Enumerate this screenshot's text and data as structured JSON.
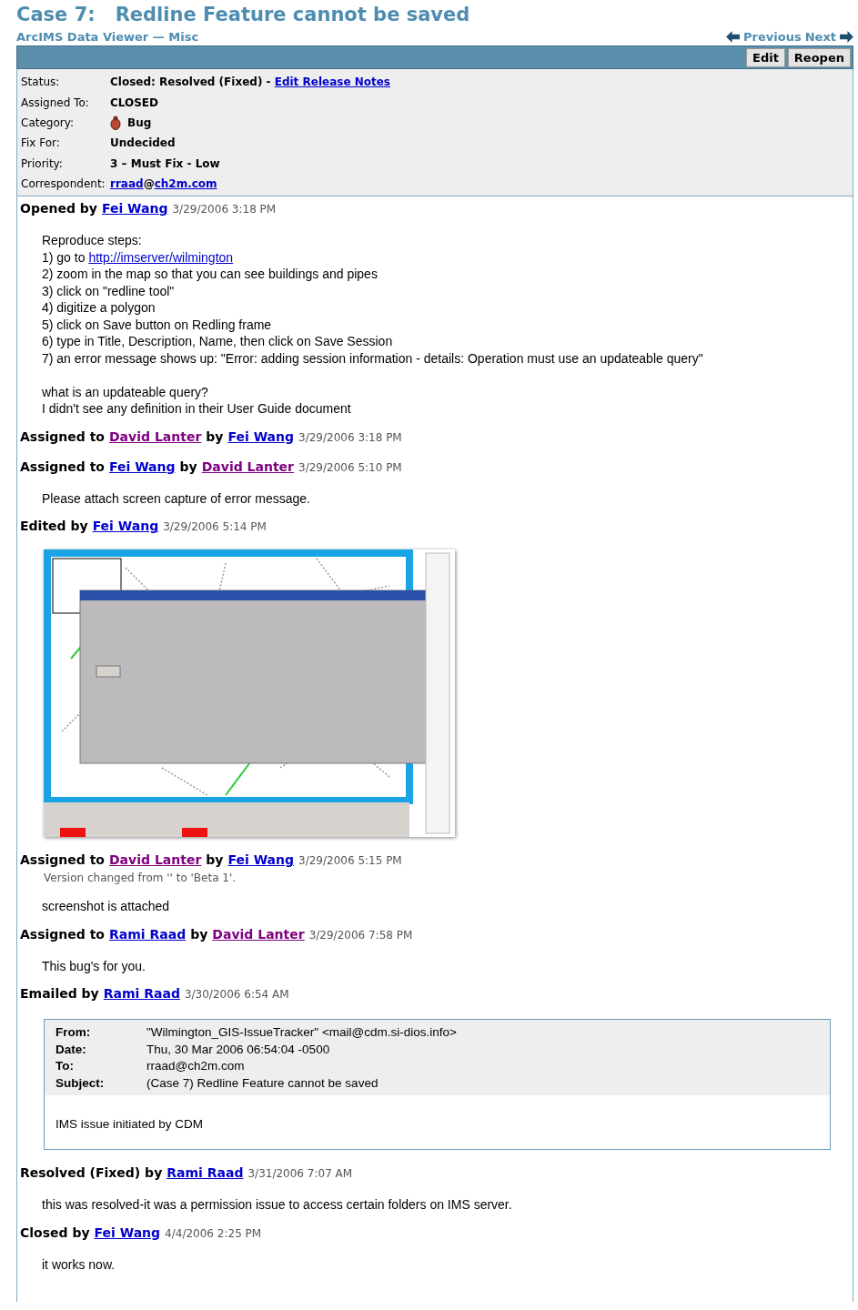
{
  "case": {
    "number": "Case 7:",
    "title": "Redline Feature cannot be saved",
    "subtitle": "ArcIMS Data Viewer — Misc"
  },
  "nav": {
    "previous": "Previous",
    "next": "Next"
  },
  "buttons": [
    "Edit",
    "Reopen"
  ],
  "properties": [
    {
      "label": "Status:",
      "kind": "text",
      "parts": [
        {
          "kind": "text",
          "text": "Closed: Resolved (Fixed) - "
        },
        {
          "kind": "link",
          "text": "Edit Release Notes"
        }
      ]
    },
    {
      "label": "Assigned To:",
      "kind": "text",
      "parts": [
        {
          "kind": "text",
          "text": "CLOSED"
        }
      ]
    },
    {
      "label": "Category:",
      "kind": "category",
      "parts": [
        {
          "kind": "text",
          "text": "Bug"
        }
      ]
    },
    {
      "label": "Fix For:",
      "kind": "text",
      "parts": [
        {
          "kind": "text",
          "text": "Undecided"
        }
      ]
    },
    {
      "label": "Priority:",
      "kind": "text",
      "parts": [
        {
          "kind": "text",
          "text": "3 – Must Fix - Low"
        }
      ]
    },
    {
      "label": "Correspondent:",
      "kind": "text",
      "parts": [
        {
          "kind": "link",
          "text": "rraad"
        },
        {
          "kind": "text",
          "text": "@"
        },
        {
          "kind": "link",
          "text": "ch2m.com"
        }
      ]
    }
  ],
  "events": [
    {
      "heading": [
        {
          "kind": "text",
          "text": "Opened by"
        },
        {
          "kind": "link",
          "text": "Fei Wang",
          "visited": false
        }
      ],
      "time": "3/29/2006 3:18 PM",
      "paragraphs": [
        [
          {
            "text": "Reproduce steps:"
          },
          {
            "text": "1) go to ",
            "link": "http://imserver/wilmington"
          },
          {
            "text": "2) zoom in the map so that you can see buildings and pipes"
          },
          {
            "text": "3) click on \"redline tool\""
          },
          {
            "text": "4) digitize a polygon"
          },
          {
            "text": "5) click on Save button on Redling frame"
          },
          {
            "text": "6) type in Title, Description, Name, then click on Save Session"
          },
          {
            "text": "7) an error message shows up: \"Error: adding session information - details: Operation must use an updateable query\""
          }
        ],
        [
          {
            "text": "what is an updateable query?"
          },
          {
            "text": "I didn't see any definition in their User Guide document"
          }
        ]
      ]
    },
    {
      "heading": [
        {
          "kind": "text",
          "text": "Assigned to"
        },
        {
          "kind": "link",
          "text": "David Lanter",
          "visited": true
        },
        {
          "kind": "text",
          "text": "by"
        },
        {
          "kind": "link",
          "text": "Fei Wang",
          "visited": false
        }
      ],
      "time": "3/29/2006 3:18 PM"
    },
    {
      "heading": [
        {
          "kind": "text",
          "text": "Assigned to"
        },
        {
          "kind": "link",
          "text": "Fei Wang",
          "visited": false
        },
        {
          "kind": "text",
          "text": "by"
        },
        {
          "kind": "link",
          "text": "David Lanter",
          "visited": true
        }
      ],
      "time": "3/29/2006 5:10 PM",
      "paragraphs": [
        [
          {
            "text": "Please attach screen capture of error message."
          }
        ]
      ]
    },
    {
      "heading": [
        {
          "kind": "text",
          "text": "Edited by"
        },
        {
          "kind": "link",
          "text": "Fei Wang",
          "visited": false
        }
      ],
      "time": "3/29/2006 5:14 PM",
      "attachment": {
        "kind": "picture"
      }
    },
    {
      "heading": [
        {
          "kind": "text",
          "text": "Assigned to"
        },
        {
          "kind": "link",
          "text": "David Lanter",
          "visited": true
        },
        {
          "kind": "text",
          "text": "by"
        },
        {
          "kind": "link",
          "text": "Fei Wang",
          "visited": false
        }
      ],
      "time": "3/29/2006 5:15 PM",
      "note": "Version changed from '' to 'Beta 1'.",
      "paragraphs": [
        [
          {
            "text": "screenshot is attached"
          }
        ]
      ]
    },
    {
      "heading": [
        {
          "kind": "text",
          "text": "Assigned to"
        },
        {
          "kind": "link",
          "text": "Rami Raad",
          "visited": false
        },
        {
          "kind": "text",
          "text": "by"
        },
        {
          "kind": "link",
          "text": "David Lanter",
          "visited": true
        }
      ],
      "time": "3/29/2006 7:58 PM",
      "paragraphs": [
        [
          {
            "text": "This bug's for you."
          }
        ]
      ]
    },
    {
      "heading": [
        {
          "kind": "text",
          "text": "Emailed by"
        },
        {
          "kind": "link",
          "text": "Rami Raad",
          "visited": false
        }
      ],
      "time": "3/30/2006 6:54 AM",
      "email": {
        "fields": [
          {
            "label": "From:",
            "value": "\"Wilmington_GIS-IssueTracker\" <mail@cdm.si-dios.info>"
          },
          {
            "label": "Date:",
            "value": "Thu, 30 Mar 2006 06:54:04 -0500"
          },
          {
            "label": "To:",
            "value": "rraad@ch2m.com"
          },
          {
            "label": "Subject:",
            "value": "(Case 7) Redline Feature cannot be saved"
          }
        ],
        "body": "IMS issue initiated by CDM"
      }
    },
    {
      "heading": [
        {
          "kind": "text",
          "text": "Resolved (Fixed) by"
        },
        {
          "kind": "link",
          "text": "Rami Raad",
          "visited": false
        }
      ],
      "time": "3/31/2006 7:07 AM",
      "paragraphs": [
        [
          {
            "text": "this was resolved-it was a permission issue to access certain folders on IMS server."
          }
        ]
      ]
    },
    {
      "heading": [
        {
          "kind": "text",
          "text": "Closed by"
        },
        {
          "kind": "link",
          "text": "Fei Wang",
          "visited": false
        }
      ],
      "time": "4/4/2006 2:25 PM",
      "paragraphs": [
        [
          {
            "text": "it works now."
          }
        ]
      ]
    }
  ]
}
